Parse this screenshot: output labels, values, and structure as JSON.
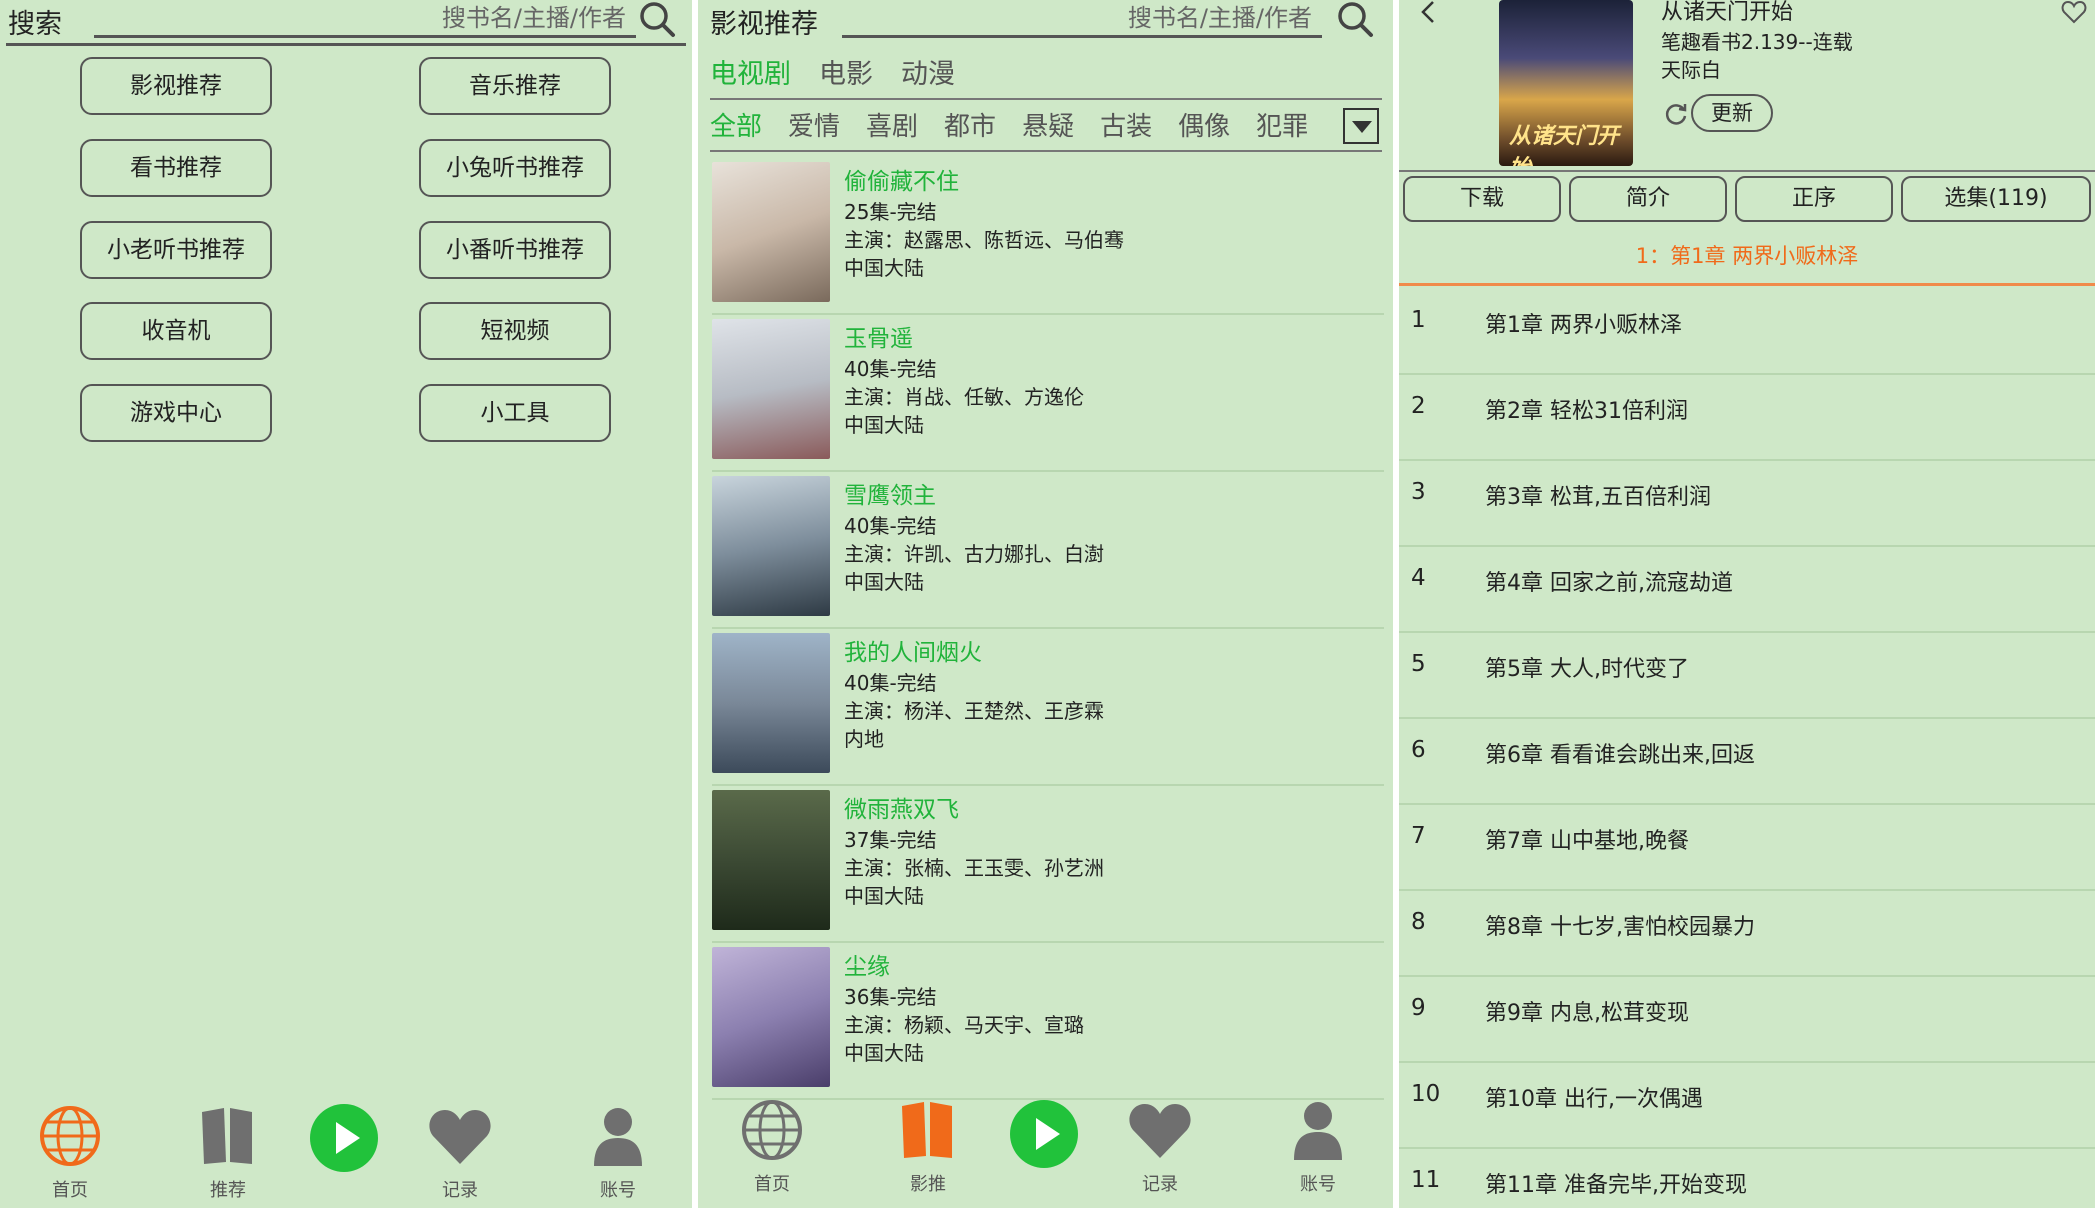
{
  "panel1": {
    "search_label": "搜索",
    "search_placeholder": "搜书名/主播/作者",
    "menu": [
      "影视推荐",
      "音乐推荐",
      "看书推荐",
      "小兔听书推荐",
      "小老听书推荐",
      "小番听书推荐",
      "收音机",
      "短视频",
      "游戏中心",
      "小工具"
    ],
    "nav": {
      "home": "首页",
      "recommend": "推荐",
      "records": "记录",
      "account": "账号"
    }
  },
  "panel2": {
    "search_label": "影视推荐",
    "search_placeholder": "搜书名/主播/作者",
    "main_tabs": [
      "电视剧",
      "电影",
      "动漫"
    ],
    "categories": [
      "全部",
      "爱情",
      "喜剧",
      "都市",
      "悬疑",
      "古装",
      "偶像",
      "犯罪"
    ],
    "videos": [
      {
        "title": "偷偷藏不住",
        "episodes": "25集-完结",
        "cast": "主演：赵露思、陈哲远、马伯骞",
        "region": "中国大陆"
      },
      {
        "title": "玉骨遥",
        "episodes": "40集-完结",
        "cast": "主演：肖战、任敏、方逸伦",
        "region": "中国大陆"
      },
      {
        "title": "雪鹰领主",
        "episodes": "40集-完结",
        "cast": "主演：许凯、古力娜扎、白澍",
        "region": "中国大陆"
      },
      {
        "title": "我的人间烟火",
        "episodes": "40集-完结",
        "cast": "主演：杨洋、王楚然、王彦霖",
        "region": "内地"
      },
      {
        "title": "微雨燕双飞",
        "episodes": "37集-完结",
        "cast": "主演：张楠、王玉雯、孙艺洲",
        "region": "中国大陆"
      },
      {
        "title": "尘缘",
        "episodes": "36集-完结",
        "cast": "主演：杨颖、马天宇、宣璐",
        "region": "中国大陆"
      }
    ],
    "nav": {
      "home": "首页",
      "recommend": "影推",
      "records": "记录",
      "account": "账号"
    }
  },
  "panel3": {
    "book_title": "从诸天门开始",
    "cover_text": "从诸天门开始",
    "source": "笔趣看书2.139--连载",
    "author": "天际白",
    "update_label": "更新",
    "buttons": [
      "下载",
      "简介",
      "正序",
      "选集(119)"
    ],
    "current_chapter": "1：第1章 两界小贩林泽",
    "chapters": [
      {
        "num": "1",
        "title": "第1章 两界小贩林泽"
      },
      {
        "num": "2",
        "title": "第2章 轻松31倍利润"
      },
      {
        "num": "3",
        "title": "第3章 松茸,五百倍利润"
      },
      {
        "num": "4",
        "title": "第4章 回家之前,流寇劫道"
      },
      {
        "num": "5",
        "title": "第5章 大人,时代变了"
      },
      {
        "num": "6",
        "title": "第6章 看看谁会跳出来,回返"
      },
      {
        "num": "7",
        "title": "第7章 山中基地,晚餐"
      },
      {
        "num": "8",
        "title": "第8章 十七岁,害怕校园暴力"
      },
      {
        "num": "9",
        "title": "第9章 内息,松茸变现"
      },
      {
        "num": "10",
        "title": "第10章 出行,一次偶遇"
      },
      {
        "num": "11",
        "title": "第11章 准备完毕,开始变现"
      }
    ]
  },
  "colors": {
    "background": "#cfe8c8",
    "accent_green": "#21b33b",
    "accent_orange": "#f06a1a",
    "icon_gray": "#6f6f6f"
  }
}
